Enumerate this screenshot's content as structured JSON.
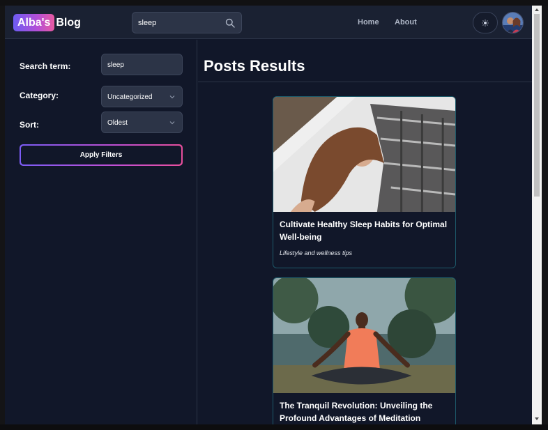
{
  "header": {
    "logo_badge": "Alba's",
    "logo_text": "Blog",
    "search_value": "sleep",
    "nav": [
      {
        "label": "Home"
      },
      {
        "label": "About"
      }
    ]
  },
  "sidebar": {
    "search_label": "Search term:",
    "search_value": "sleep",
    "category_label": "Category:",
    "category_value": "Uncategorized",
    "sort_label": "Sort:",
    "sort_value": "Oldest",
    "apply_label": "Apply Filters"
  },
  "main": {
    "title": "Posts Results",
    "posts": [
      {
        "title": "Cultivate Healthy Sleep Habits for Optimal Well-being",
        "subtitle": "Lifestyle and wellness tips"
      },
      {
        "title": "The Tranquil Revolution: Unveiling the Profound Advantages of Meditation",
        "subtitle": ""
      }
    ]
  },
  "colors": {
    "background": "#111729",
    "panel": "#2c3447",
    "accent_gradient_start": "#7b5cf5",
    "accent_gradient_end": "#e84f9c",
    "card_border": "#1d5a6a"
  }
}
